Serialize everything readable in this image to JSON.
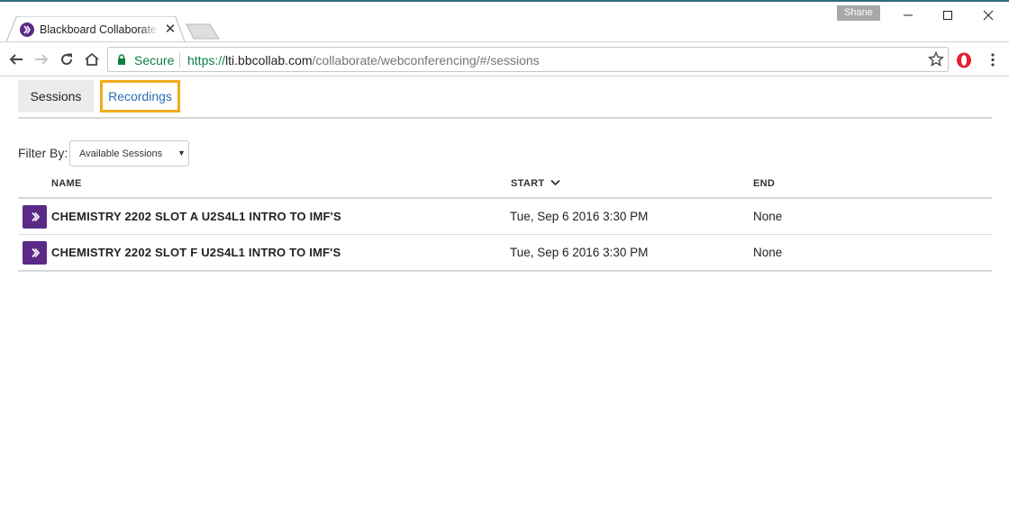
{
  "browser": {
    "tab_title": "Blackboard Collaborate Web Conferencing",
    "profile_name": "Shane",
    "omnibox": {
      "secure_label": "Secure",
      "url_scheme": "https://",
      "url_host": "lti.bbcollab.com",
      "url_path": "/collaborate/webconferencing/#/sessions"
    },
    "icons": [
      "back-icon",
      "forward-icon",
      "reload-icon",
      "home-icon",
      "lock-icon",
      "star-icon",
      "opera-icon",
      "menu-icon",
      "minimize-icon",
      "maximize-icon",
      "close-icon"
    ]
  },
  "page": {
    "tabs": [
      {
        "label": "Sessions",
        "active": true
      },
      {
        "label": "Recordings",
        "active": false,
        "highlighted": true
      }
    ],
    "filter": {
      "label": "Filter By:",
      "selected": "Available Sessions"
    },
    "table": {
      "columns": {
        "name": "NAME",
        "start": "START",
        "end": "END"
      },
      "sort": {
        "column": "start",
        "direction": "descending"
      },
      "rows": [
        {
          "name": "CHEMISTRY 2202 SLOT A U2S4L1 INTRO TO IMF'S",
          "start": "Tue, Sep 6 2016 3:30 PM",
          "end": "None"
        },
        {
          "name": "CHEMISTRY 2202 SLOT F U2S4L1 INTRO TO IMF'S",
          "start": "Tue, Sep 6 2016 3:30 PM",
          "end": "None"
        }
      ]
    }
  },
  "colors": {
    "brand_purple": "#5b2a86",
    "highlight_orange": "#f2ab1b",
    "link_blue": "#2c6eb5",
    "secure_green": "#0b8043"
  }
}
